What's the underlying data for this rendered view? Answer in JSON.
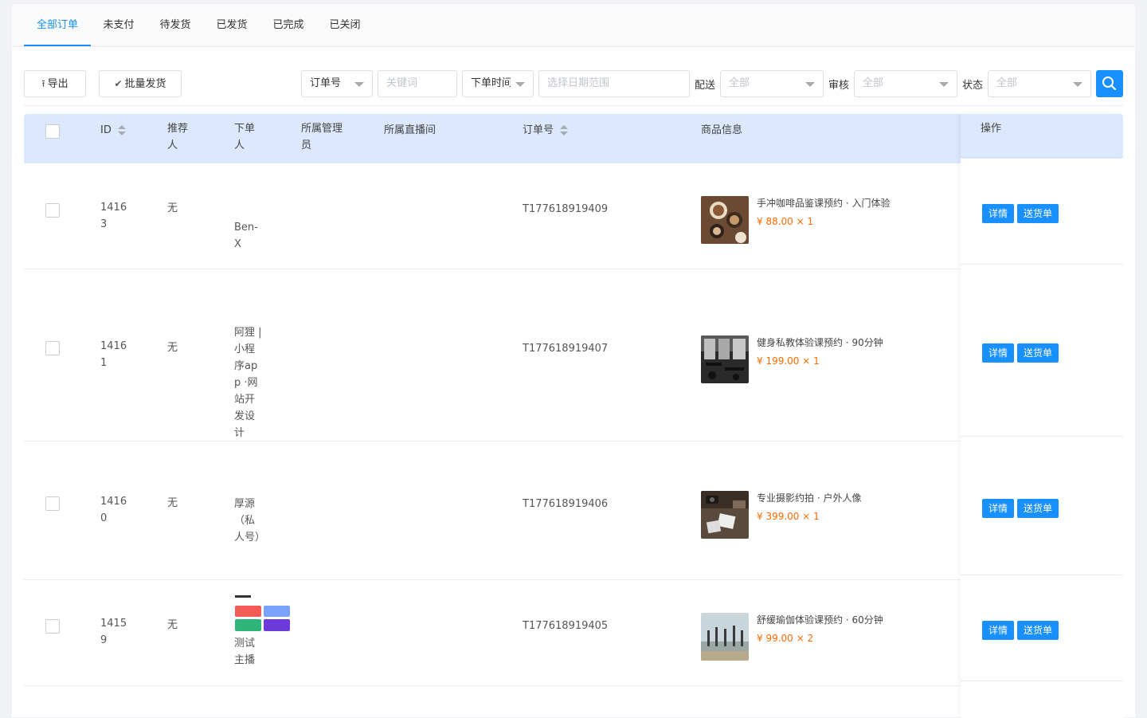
{
  "tabs": [
    "全部订单",
    "未支付",
    "待发货",
    "已发货",
    "已完成",
    "已关闭"
  ],
  "toolbar": {
    "export_label": "导出",
    "batch_ship_label": "批量发货",
    "order_no_select": "订单号",
    "keyword_placeholder": "关键词",
    "time_select": "下单时间",
    "date_range_placeholder": "选择日期范围",
    "delivery_label": "配送",
    "delivery_value": "全部",
    "review_label": "审核",
    "review_value": "全部",
    "status_label": "状态",
    "status_value": "全部"
  },
  "table": {
    "headers": {
      "id": "ID",
      "referrer": "推荐人",
      "buyer": "下单人",
      "manager": "所属管理员",
      "live_room": "所属直播间",
      "order_no": "订单号",
      "product": "商品信息",
      "action": "操作"
    },
    "rows": [
      {
        "id": "14163",
        "referrer": "无",
        "buyer": "Ben-X",
        "order_no": "T177618919409",
        "product_name": "手冲咖啡品鉴课预约 · 入门体验",
        "price": "¥ 88.00 × 1",
        "thumb": "coffee"
      },
      {
        "id": "14161",
        "referrer": "无",
        "buyer": "阿狸 | 小程序app ·网站开发设计",
        "order_no": "T177618919407",
        "product_name": "健身私教体验课预约 · 90分钟",
        "price": "¥ 199.00 × 1",
        "thumb": "gym"
      },
      {
        "id": "14160",
        "referrer": "无",
        "buyer": "厚源 （私人号）",
        "order_no": "T177618919406",
        "product_name": "专业摄影约拍 · 户外人像",
        "price": "¥ 399.00 × 1",
        "thumb": "photo"
      },
      {
        "id": "14159",
        "referrer": "无",
        "buyer": "测试主播",
        "order_no": "T177618919405",
        "product_name": "舒缓瑜伽体验课预约 · 60分钟",
        "price": "¥ 99.00 × 2",
        "thumb": "yoga"
      }
    ],
    "detail_label": "详情",
    "ship_label": "送货单"
  },
  "colors": {
    "accent": "#1890ff",
    "header_bg": "#dce8fd",
    "price": "#ff6a00"
  }
}
